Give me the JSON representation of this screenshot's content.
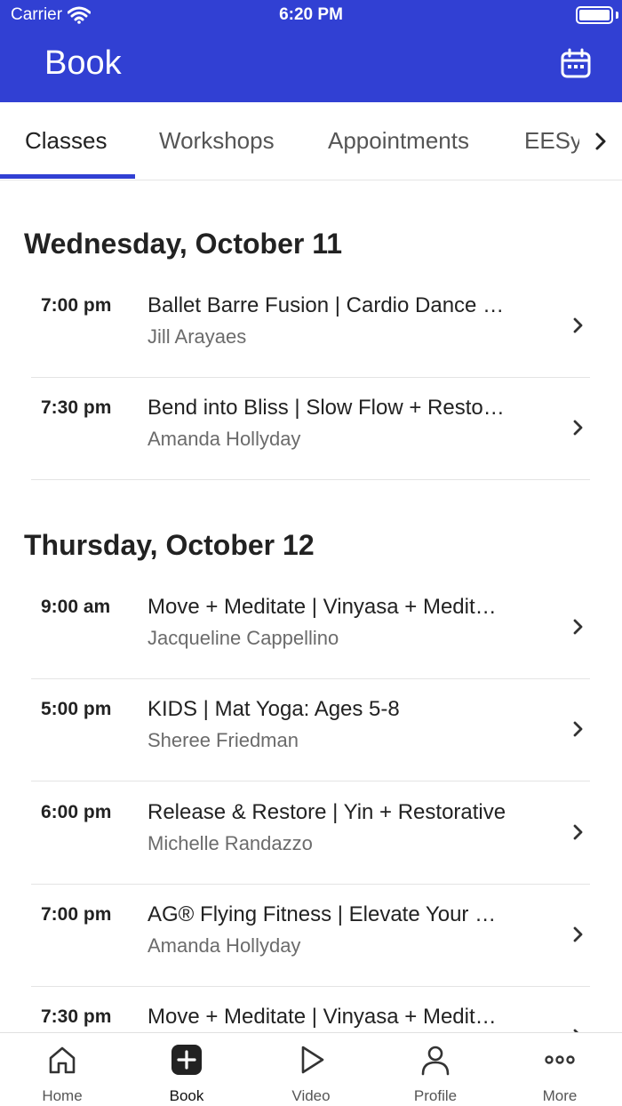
{
  "status_bar": {
    "carrier": "Carrier",
    "time": "6:20 PM"
  },
  "header": {
    "title": "Book",
    "calendar_icon": "calendar-icon",
    "background": "#3140d3"
  },
  "tabs": [
    {
      "label": "Classes",
      "active": true
    },
    {
      "label": "Workshops",
      "active": false
    },
    {
      "label": "Appointments",
      "active": false
    },
    {
      "label": "EESy",
      "active": false
    }
  ],
  "days": [
    {
      "heading": "Wednesday, October 11",
      "classes": [
        {
          "time": "7:00 pm",
          "name": "Ballet Barre Fusion | Cardio Dance …",
          "instructor": "Jill Arayaes"
        },
        {
          "time": "7:30 pm",
          "name": "Bend into Bliss | Slow Flow + Resto…",
          "instructor": "Amanda Hollyday"
        }
      ]
    },
    {
      "heading": "Thursday, October 12",
      "classes": [
        {
          "time": "9:00 am",
          "name": "Move + Meditate | Vinyasa + Medit…",
          "instructor": "Jacqueline Cappellino"
        },
        {
          "time": "5:00 pm",
          "name": "KIDS | Mat Yoga: Ages 5-8",
          "instructor": "Sheree Friedman"
        },
        {
          "time": "6:00 pm",
          "name": "Release & Restore | Yin + Restorative",
          "instructor": "Michelle Randazzo"
        },
        {
          "time": "7:00 pm",
          "name": "AG® Flying Fitness | Elevate Your …",
          "instructor": "Amanda Hollyday"
        },
        {
          "time": "7:30 pm",
          "name": "Move + Meditate | Vinyasa + Medit…",
          "instructor": ""
        }
      ]
    }
  ],
  "bottom_nav": [
    {
      "label": "Home",
      "icon": "home-icon",
      "active": false
    },
    {
      "label": "Book",
      "icon": "book-plus-icon",
      "active": true
    },
    {
      "label": "Video",
      "icon": "play-icon",
      "active": false
    },
    {
      "label": "Profile",
      "icon": "person-icon",
      "active": false
    },
    {
      "label": "More",
      "icon": "more-dots-icon",
      "active": false
    }
  ]
}
